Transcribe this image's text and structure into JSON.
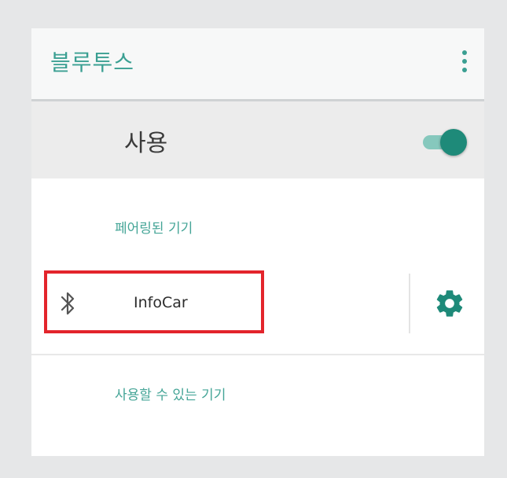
{
  "appbar": {
    "title": "블루투스",
    "more_icon": "more-vert-icon",
    "accent_color": "#3a9f92"
  },
  "master_switch": {
    "label": "사용",
    "state": "on"
  },
  "paired": {
    "header": "페어링된 기기",
    "devices": [
      {
        "name": "InfoCar",
        "icon": "bluetooth-icon",
        "settings_icon": "gear-icon",
        "highlight_color": "#e3242b"
      }
    ]
  },
  "available": {
    "header": "사용할 수 있는 기기"
  }
}
